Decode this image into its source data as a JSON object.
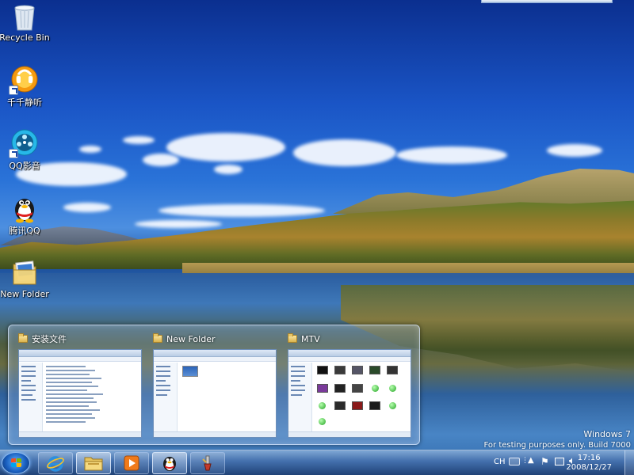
{
  "desktop_icons": [
    {
      "label": "Recycle Bin",
      "icon": "recycle-bin-icon"
    },
    {
      "label": "千千静听",
      "icon": "ttplayer-icon"
    },
    {
      "label": "QQ影音",
      "icon": "qq-player-icon"
    },
    {
      "label": "腾讯QQ",
      "icon": "qq-penguin-icon"
    },
    {
      "label": "New Folder",
      "icon": "folder-icon"
    }
  ],
  "thumbnails": [
    {
      "title": "安装文件"
    },
    {
      "title": "New Folder"
    },
    {
      "title": "MTV"
    }
  ],
  "watermark": {
    "line1": "Windows 7",
    "line2": "For testing purposes only. Build 7000"
  },
  "taskbar": {
    "buttons": [
      {
        "icon": "internet-explorer-icon"
      },
      {
        "icon": "windows-explorer-icon"
      },
      {
        "icon": "media-player-icon"
      },
      {
        "icon": "qq-penguin-icon"
      },
      {
        "icon": "paint-brush-icon"
      }
    ],
    "language": "CH",
    "time": "17:16",
    "date": "2008/12/27"
  }
}
